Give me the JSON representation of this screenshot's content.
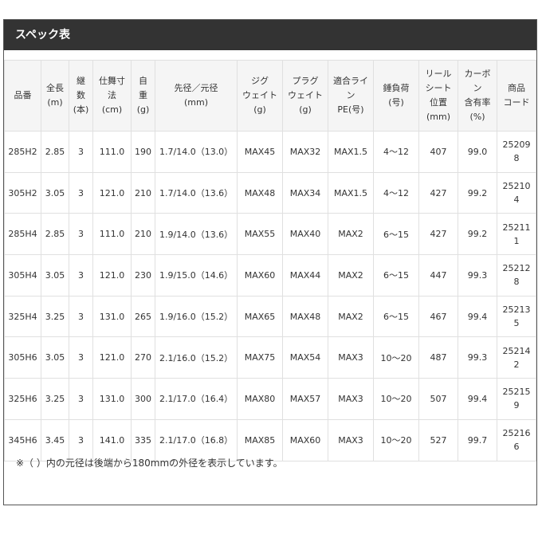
{
  "title": "スペック表",
  "headers": [
    [
      "品番"
    ],
    [
      "全長",
      "(m)"
    ],
    [
      "継",
      "数",
      "(本)"
    ],
    [
      "仕舞寸",
      "法",
      "(cm)"
    ],
    [
      "自",
      "重",
      "(g)"
    ],
    [
      "先径／元径",
      "(mm)"
    ],
    [
      "ジグ",
      "ウェイト",
      "(g)"
    ],
    [
      "プラグ",
      "ウェイト",
      "(g)"
    ],
    [
      "適合ライ",
      "ン",
      "PE(号)"
    ],
    [
      "錘負荷",
      "(号)"
    ],
    [
      "リール",
      "シート",
      "位置",
      "(mm)"
    ],
    [
      "カーボ",
      "ン",
      "含有率",
      "(%)"
    ],
    [
      "商品",
      "コード"
    ]
  ],
  "rows": [
    {
      "model": "285H2",
      "length": "2.85",
      "pieces": "3",
      "closed": "111.0",
      "weight": "190",
      "diameter": "1.7/14.0（13.0）",
      "jig": "MAX45",
      "plug": "MAX32",
      "line": "MAX1.5",
      "sinker": "4〜12",
      "reel_seat": "407",
      "carbon": "99.0",
      "code": [
        "25209",
        "8"
      ]
    },
    {
      "model": "305H2",
      "length": "3.05",
      "pieces": "3",
      "closed": "121.0",
      "weight": "210",
      "diameter": "1.7/14.0（13.6）",
      "jig": "MAX48",
      "plug": "MAX34",
      "line": "MAX1.5",
      "sinker": "4〜12",
      "reel_seat": "427",
      "carbon": "99.2",
      "code": [
        "25210",
        "4"
      ]
    },
    {
      "model": "285H4",
      "length": "2.85",
      "pieces": "3",
      "closed": "111.0",
      "weight": "210",
      "diameter": "1.9/14.0（13.6）",
      "jig": "MAX55",
      "plug": "MAX40",
      "line": "MAX2",
      "sinker": "6〜15",
      "reel_seat": "427",
      "carbon": "99.2",
      "code": [
        "25211",
        "1"
      ]
    },
    {
      "model": "305H4",
      "length": "3.05",
      "pieces": "3",
      "closed": "121.0",
      "weight": "230",
      "diameter": "1.9/15.0（14.6）",
      "jig": "MAX60",
      "plug": "MAX44",
      "line": "MAX2",
      "sinker": "6〜15",
      "reel_seat": "447",
      "carbon": "99.3",
      "code": [
        "25212",
        "8"
      ]
    },
    {
      "model": "325H4",
      "length": "3.25",
      "pieces": "3",
      "closed": "131.0",
      "weight": "265",
      "diameter": "1.9/16.0（15.2）",
      "jig": "MAX65",
      "plug": "MAX48",
      "line": "MAX2",
      "sinker": "6〜15",
      "reel_seat": "467",
      "carbon": "99.4",
      "code": [
        "25213",
        "5"
      ]
    },
    {
      "model": "305H6",
      "length": "3.05",
      "pieces": "3",
      "closed": "121.0",
      "weight": "270",
      "diameter": "2.1/16.0（15.2）",
      "jig": "MAX75",
      "plug": "MAX54",
      "line": "MAX3",
      "sinker": "10〜20",
      "reel_seat": "487",
      "carbon": "99.3",
      "code": [
        "25214",
        "2"
      ]
    },
    {
      "model": "325H6",
      "length": "3.25",
      "pieces": "3",
      "closed": "131.0",
      "weight": "300",
      "diameter": "2.1/17.0（16.4）",
      "jig": "MAX80",
      "plug": "MAX57",
      "line": "MAX3",
      "sinker": "10〜20",
      "reel_seat": "507",
      "carbon": "99.4",
      "code": [
        "25215",
        "9"
      ]
    },
    {
      "model": "345H6",
      "length": "3.45",
      "pieces": "3",
      "closed": "141.0",
      "weight": "335",
      "diameter": "2.1/17.0（16.8）",
      "jig": "MAX85",
      "plug": "MAX60",
      "line": "MAX3",
      "sinker": "10〜20",
      "reel_seat": "527",
      "carbon": "99.7",
      "code": [
        "25216",
        "6"
      ]
    }
  ],
  "note": "※（ ）内の元径は後端から180mmの外径を表示しています。",
  "colors": {
    "title_bg": "#333333",
    "title_text": "#ffffff",
    "header_bg": "#f5f5f5",
    "grid": "#e0e0e0",
    "text": "#333333"
  }
}
